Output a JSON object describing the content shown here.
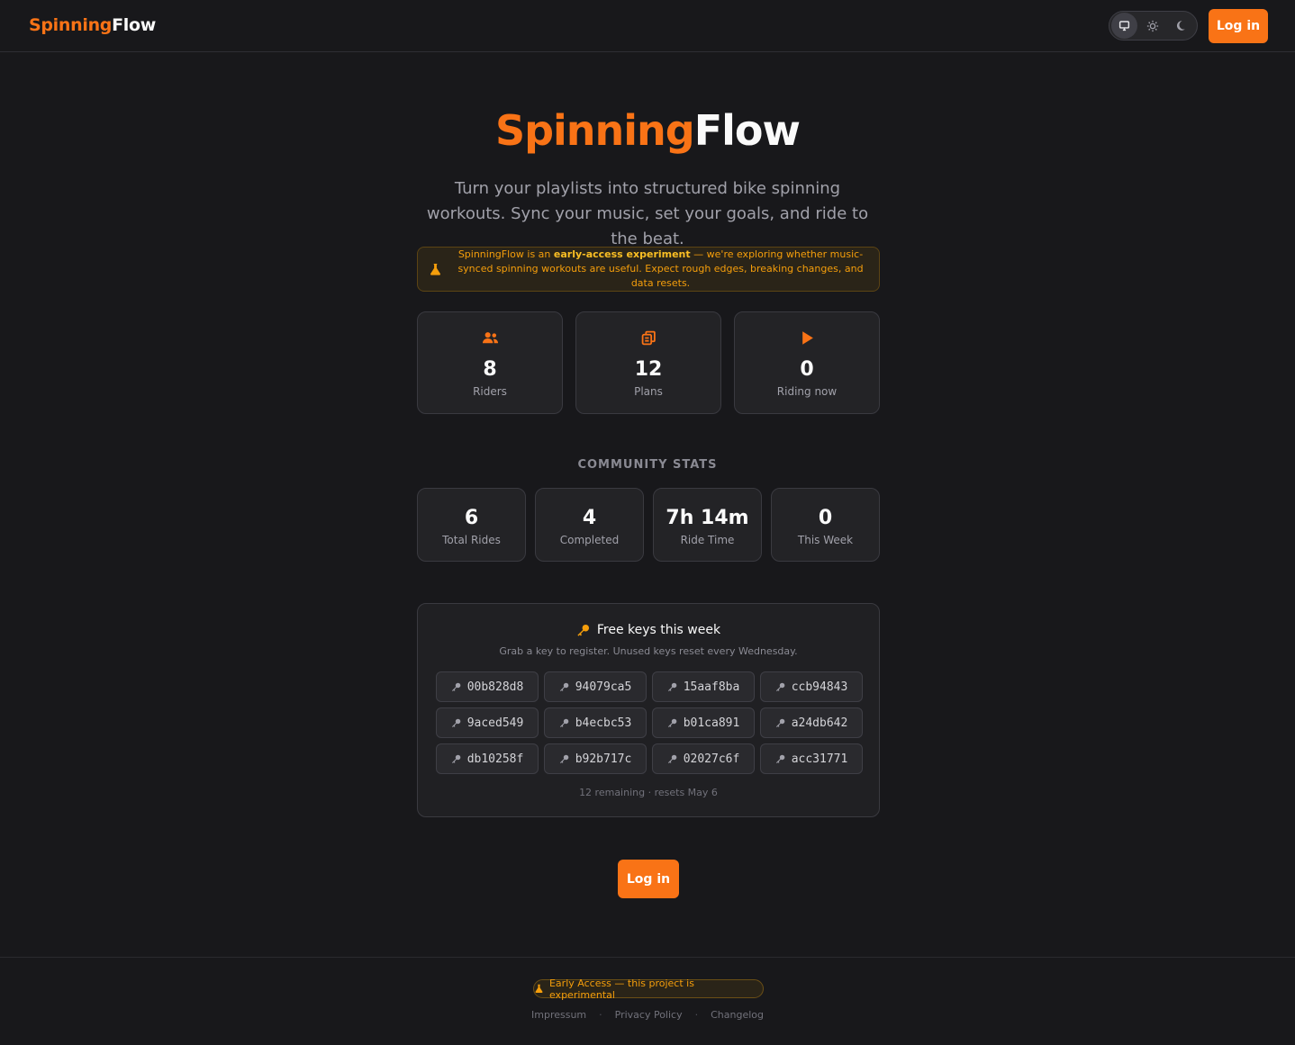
{
  "header": {
    "brand_part1": "Spinning",
    "brand_part2": "Flow",
    "theme_options": [
      "monitor-icon",
      "sun-icon",
      "moon-icon"
    ],
    "login_label": "Log in"
  },
  "hero": {
    "title_part1": "Spinning",
    "title_part2": "Flow",
    "subtitle": "Turn your playlists into structured bike spinning workouts. Sync your music, set your goals, and ride to the beat.",
    "banner_pre": "SpinningFlow is an ",
    "banner_bold": "early-access experiment",
    "banner_post": " — we're exploring whether music-synced spinning workouts are useful. Expect rough edges, breaking changes, and data resets."
  },
  "stats": [
    {
      "icon": "users-icon",
      "value": "8",
      "label": "Riders"
    },
    {
      "icon": "documents-icon",
      "value": "12",
      "label": "Plans"
    },
    {
      "icon": "play-icon",
      "value": "0",
      "label": "Riding now"
    }
  ],
  "community": {
    "title": "COMMUNITY STATS",
    "items": [
      {
        "value": "6",
        "label": "Total Rides"
      },
      {
        "value": "4",
        "label": "Completed"
      },
      {
        "value": "7h 14m",
        "label": "Ride Time"
      },
      {
        "value": "0",
        "label": "This Week"
      }
    ]
  },
  "keys": {
    "title": "Free keys this week",
    "subtitle": "Grab a key to register. Unused keys reset every Wednesday.",
    "list": [
      "00b828d8",
      "94079ca5",
      "15aaf8ba",
      "ccb94843",
      "9aced549",
      "b4ecbc53",
      "b01ca891",
      "a24db642",
      "db10258f",
      "b92b717c",
      "02027c6f",
      "acc31771"
    ],
    "footer": "12 remaining · resets May 6"
  },
  "cta": {
    "login_label": "Log in"
  },
  "footer": {
    "badge": "Early Access — this project is experimental",
    "links": [
      "Impressum",
      "Privacy Policy",
      "Changelog"
    ]
  },
  "colors": {
    "accent": "#f97316",
    "warning": "#f59e0b",
    "background": "#18181b"
  }
}
